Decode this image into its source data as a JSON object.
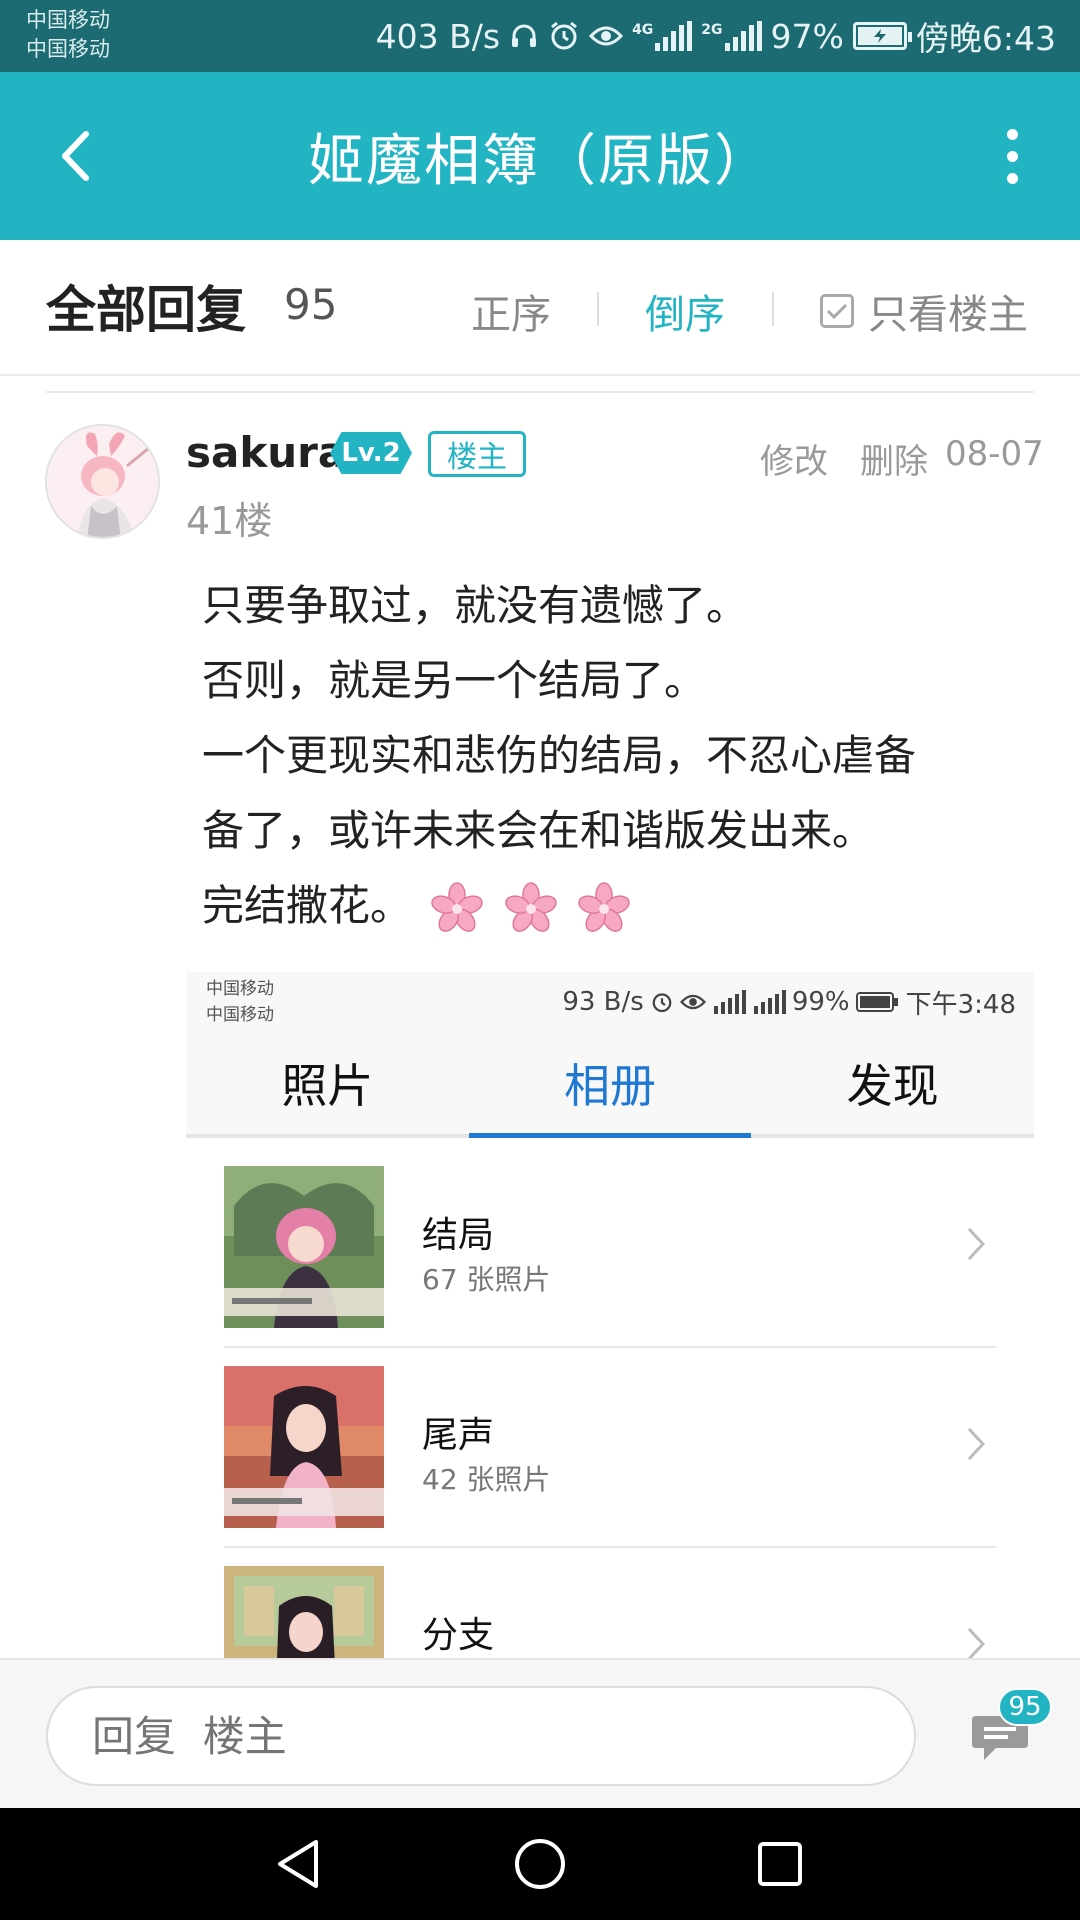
{
  "status_bar": {
    "carrier_1": "中国移动",
    "carrier_2": "中国移动",
    "network_speed": "403 B/s",
    "net_type_1": "4G",
    "net_type_2": "2G",
    "battery": "97%",
    "time": "傍晚6:43"
  },
  "header": {
    "title": "姬魔相簿（原版）"
  },
  "filter": {
    "all_replies_label": "全部回复",
    "reply_count": "95",
    "sort_asc_label": "正序",
    "sort_desc_label": "倒序",
    "sort_selected": "倒序",
    "only_op_label": "只看楼主",
    "only_op_checked": false
  },
  "post": {
    "username": "sakura",
    "level": "Lv.2",
    "op_badge": "楼主",
    "floor": "41楼",
    "edit_label": "修改",
    "delete_label": "删除",
    "date": "08-07",
    "lines": [
      "只要争取过，就没有遗憾了。",
      "否则，就是另一个结局了。",
      "一个更现实和悲伤的结局，不忍心虐备",
      "备了，或许未来会在和谐版发出来。",
      "完结撒花。"
    ],
    "emoji": "cherry-blossom-icon"
  },
  "embedded_screenshot": {
    "status": {
      "carrier_1": "中国移动",
      "carrier_2": "中国移动",
      "network_speed": "93 B/s",
      "battery": "99%",
      "time": "下午3:48"
    },
    "tabs": [
      "照片",
      "相册",
      "发现"
    ],
    "active_tab": "相册",
    "albums": [
      {
        "name": "结局",
        "count": "67 张照片"
      },
      {
        "name": "尾声",
        "count": "42 张照片"
      },
      {
        "name": "分支",
        "count": ""
      }
    ]
  },
  "reply_bar": {
    "placeholder": "回复  楼主",
    "comment_count": "95"
  },
  "colors": {
    "accent": "#23b4c4",
    "status_bar": "#1c6a72",
    "tab_active": "#1f78d1"
  }
}
